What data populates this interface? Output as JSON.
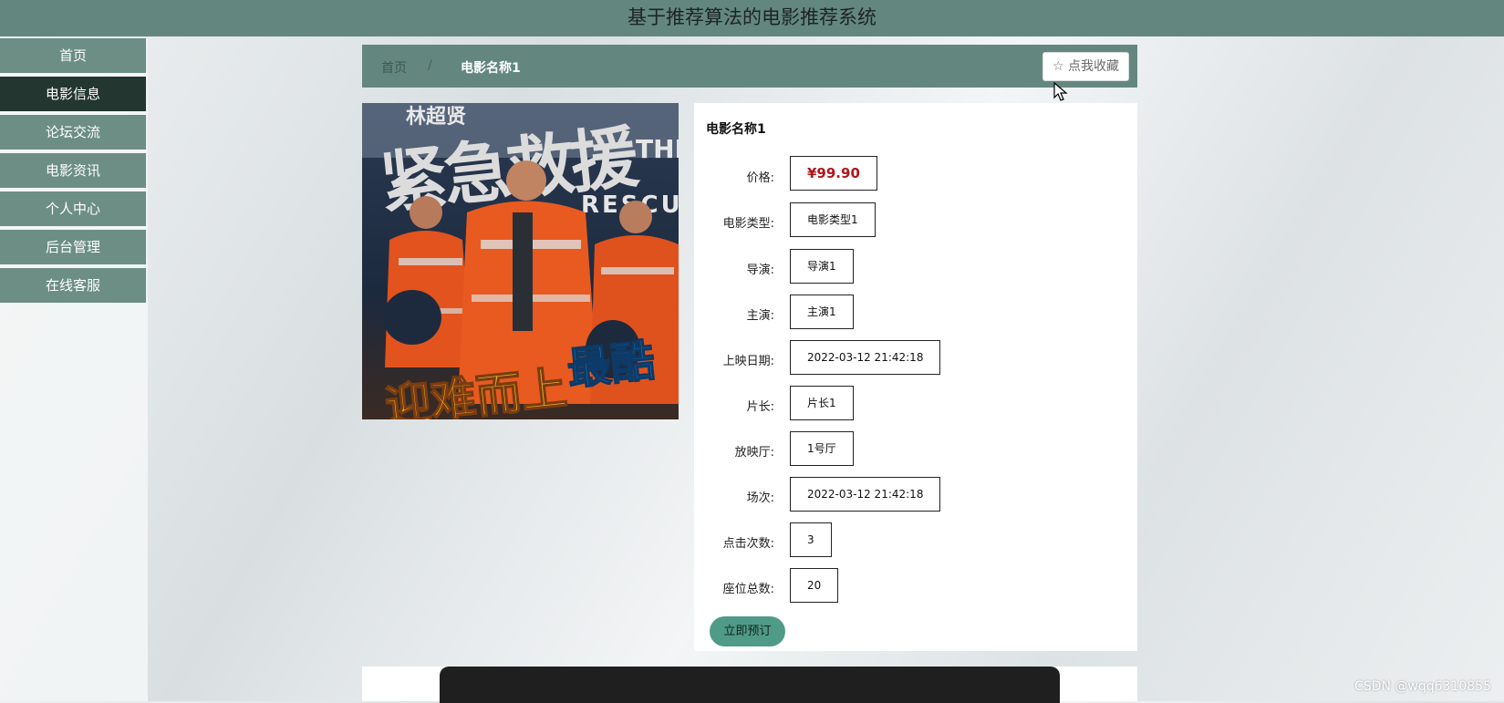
{
  "app_title": "基于推荐算法的电影推荐系统",
  "sidebar": {
    "items": [
      {
        "label": "首页",
        "active": false
      },
      {
        "label": "电影信息",
        "active": true
      },
      {
        "label": "论坛交流",
        "active": false
      },
      {
        "label": "电影资讯",
        "active": false
      },
      {
        "label": "个人中心",
        "active": false
      },
      {
        "label": "后台管理",
        "active": false
      },
      {
        "label": "在线客服",
        "active": false
      }
    ]
  },
  "breadcrumb": {
    "home": "首页",
    "separator": "/",
    "current": "电影名称1"
  },
  "favorite_button": {
    "icon": "star-outline-icon",
    "label": "点我收藏"
  },
  "poster": {
    "title_text": "紧急救援",
    "english_title": [
      "THE",
      "RESCUE"
    ],
    "slogan_left": "迎难而上",
    "slogan_right": "最酷",
    "top_text": "林超贤"
  },
  "movie": {
    "title": "电影名称1",
    "fields": [
      {
        "label": "价格:",
        "value": "¥99.90"
      },
      {
        "label": "电影类型:",
        "value": "电影类型1"
      },
      {
        "label": "导演:",
        "value": "导演1"
      },
      {
        "label": "主演:",
        "value": "主演1"
      },
      {
        "label": "上映日期:",
        "value": "2022-03-12 21:42:18"
      },
      {
        "label": "片长:",
        "value": "片长1"
      },
      {
        "label": "放映厅:",
        "value": "1号厅"
      },
      {
        "label": "场次:",
        "value": "2022-03-12 21:42:18"
      },
      {
        "label": "点击次数:",
        "value": "3"
      },
      {
        "label": "座位总数:",
        "value": "20"
      }
    ],
    "book_button": "立即预订"
  },
  "watermark": "CSDN @wqq6310855",
  "colors": {
    "header": "#63877f",
    "sidebar_item": "#6c8e85",
    "sidebar_active": "#23362f",
    "price": "#b0151b",
    "book_button": "#4f9b87"
  }
}
